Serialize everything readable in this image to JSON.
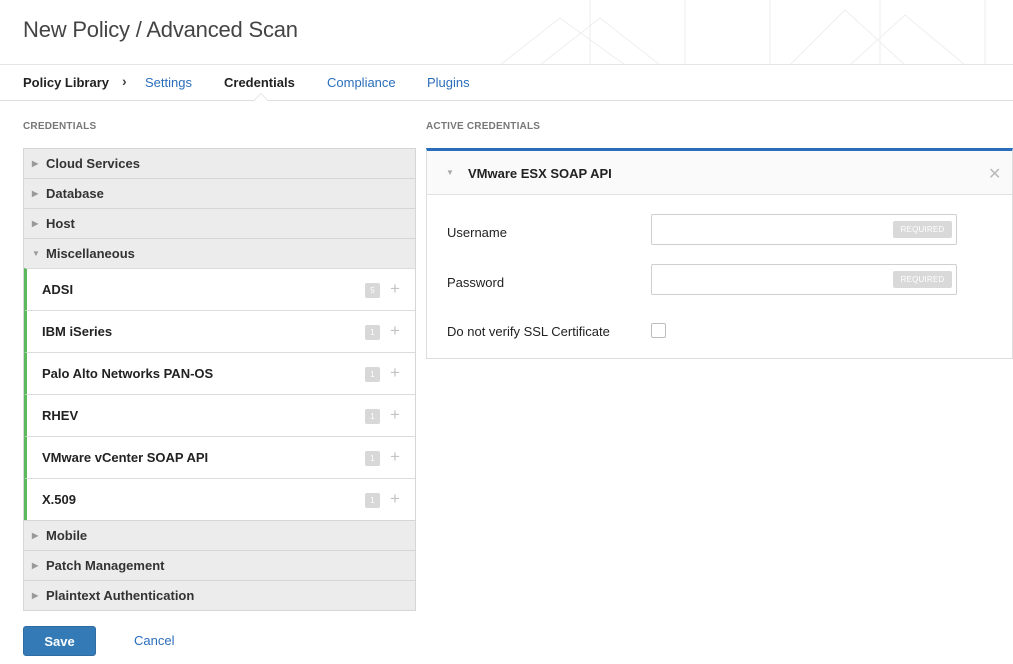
{
  "header": {
    "title": "New Policy / Advanced Scan"
  },
  "nav": {
    "breadcrumb_root": "Policy Library",
    "separator": "›",
    "tabs": [
      {
        "label": "Settings",
        "active": false
      },
      {
        "label": "Credentials",
        "active": true
      },
      {
        "label": "Compliance",
        "active": false
      },
      {
        "label": "Plugins",
        "active": false
      }
    ]
  },
  "credentials_panel": {
    "heading": "CREDENTIALS",
    "categories_top": [
      "Cloud Services",
      "Database",
      "Host"
    ],
    "expanded_category": "Miscellaneous",
    "items": [
      {
        "label": "ADSI",
        "count": "5"
      },
      {
        "label": "IBM iSeries",
        "count": "1"
      },
      {
        "label": "Palo Alto Networks PAN-OS",
        "count": "1"
      },
      {
        "label": "RHEV",
        "count": "1"
      },
      {
        "label": "VMware vCenter SOAP API",
        "count": "1"
      },
      {
        "label": "X.509",
        "count": "1"
      }
    ],
    "categories_bottom": [
      "Mobile",
      "Patch Management",
      "Plaintext Authentication"
    ],
    "add_symbol": "+"
  },
  "active_panel": {
    "heading": "ACTIVE CREDENTIALS",
    "credential_title": "VMware ESX SOAP API",
    "close_symbol": "✕",
    "fields": {
      "username_label": "Username",
      "username_value": "",
      "password_label": "Password",
      "password_value": "",
      "required_badge": "REQUIRED",
      "ssl_label": "Do not verify SSL Certificate",
      "ssl_checked": false
    }
  },
  "actions": {
    "save_label": "Save",
    "cancel_label": "Cancel"
  },
  "colors": {
    "accent": "#337ab7",
    "link": "#2a6ebb",
    "active_item_border": "#5cb85c"
  }
}
